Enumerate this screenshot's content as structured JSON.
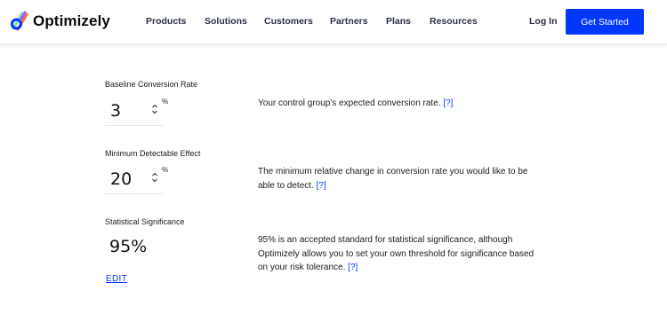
{
  "header": {
    "logo_text": "Optimizely",
    "nav": [
      "Products",
      "Solutions",
      "Customers",
      "Partners",
      "Plans",
      "Resources"
    ],
    "login_label": "Log In",
    "cta_label": "Get Started"
  },
  "colors": {
    "accent": "#0037ff",
    "text": "#1c1c1c",
    "nav_text": "#2d3148"
  },
  "fields": {
    "baseline": {
      "label": "Baseline Conversion Rate",
      "value": "3",
      "unit": "%",
      "description": "Your control group's expected conversion rate.",
      "help": "[?]"
    },
    "mde": {
      "label": "Minimum Detectable Effect",
      "value": "20",
      "unit": "%",
      "description_line1": "The minimum relative change in conversion rate you would like to be",
      "description_line2": "able to detect.",
      "help": "[?]"
    },
    "significance": {
      "label": "Statistical Significance",
      "value": "95%",
      "edit_label": "EDIT",
      "description_line1": "95% is an accepted standard for statistical significance, although",
      "description_line2": "Optimizely allows you to set your own threshold for significance based",
      "description_line3": "on your risk tolerance.",
      "help": "[?]"
    }
  },
  "icons": {
    "stepper": "up-down-chevron-icon",
    "logo": "optimizely-logo-icon"
  }
}
